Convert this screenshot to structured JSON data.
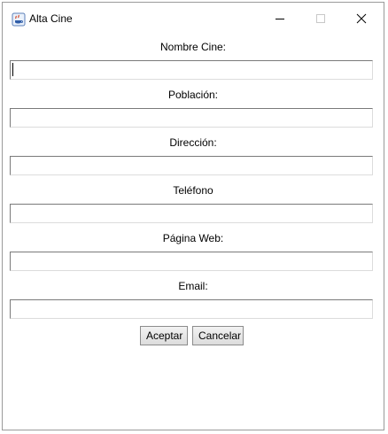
{
  "window": {
    "title": "Alta Cine",
    "icon": "java-cup-icon",
    "controls": [
      "minimize",
      "maximize",
      "close"
    ]
  },
  "form": {
    "fields": [
      {
        "label": "Nombre Cine:",
        "value": ""
      },
      {
        "label": "Población:",
        "value": ""
      },
      {
        "label": "Dirección:",
        "value": ""
      },
      {
        "label": "Teléfono",
        "value": ""
      },
      {
        "label": "Página Web:",
        "value": ""
      },
      {
        "label": "Email:",
        "value": ""
      }
    ]
  },
  "buttons": {
    "accept_label": "Aceptar",
    "cancel_label": "Cancelar"
  }
}
